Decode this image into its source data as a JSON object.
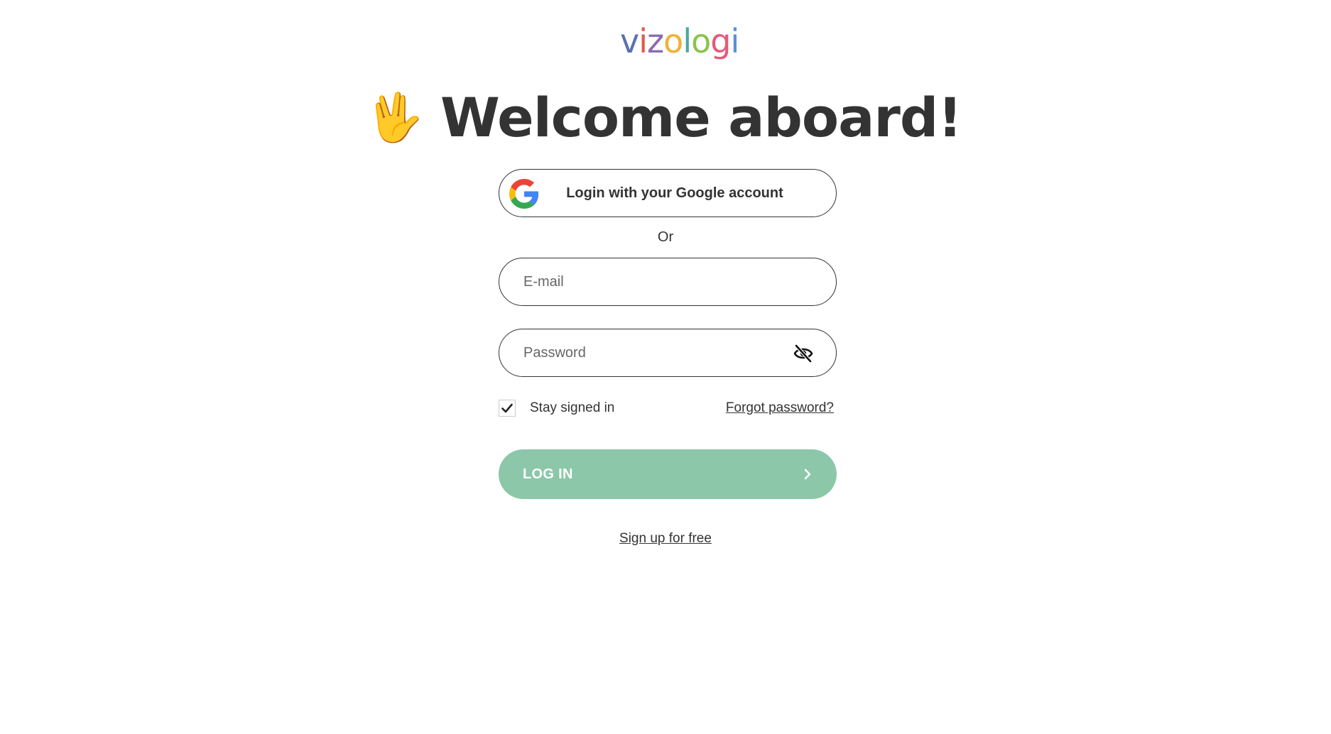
{
  "logo": {
    "text": "vizologi",
    "letters": [
      {
        "char": "v",
        "color": "#5b6fb5"
      },
      {
        "char": "i",
        "color": "#e2574c"
      },
      {
        "char": "z",
        "color": "#8c6bb1"
      },
      {
        "char": "o",
        "color": "#f2b035"
      },
      {
        "char": "l",
        "color": "#4aa8a2"
      },
      {
        "char": "o",
        "color": "#8bc34a"
      },
      {
        "char": "g",
        "color": "#e45a7c"
      },
      {
        "char": "i",
        "color": "#5b8fd6"
      }
    ]
  },
  "header": {
    "emoji": "🖖",
    "emoji_icon": "vulcan-salute-icon",
    "title": "Welcome aboard!"
  },
  "google_login": {
    "label": "Login with your Google account",
    "icon": "google-icon"
  },
  "divider": {
    "label": "Or"
  },
  "email_field": {
    "value": "",
    "placeholder": "E-mail"
  },
  "password_field": {
    "value": "",
    "placeholder": "Password",
    "toggle_icon": "eye-slash-icon"
  },
  "options": {
    "stay_signed_in_label": "Stay signed in",
    "stay_signed_in_checked": true,
    "forgot_password_label": "Forgot password?"
  },
  "login_button": {
    "label": "LOG IN",
    "icon": "chevron-right-icon",
    "color": "#8cc7a9"
  },
  "signup": {
    "label": "Sign up for free"
  },
  "colors": {
    "text": "#333333",
    "background": "#ffffff",
    "accent": "#8cc7a9"
  }
}
